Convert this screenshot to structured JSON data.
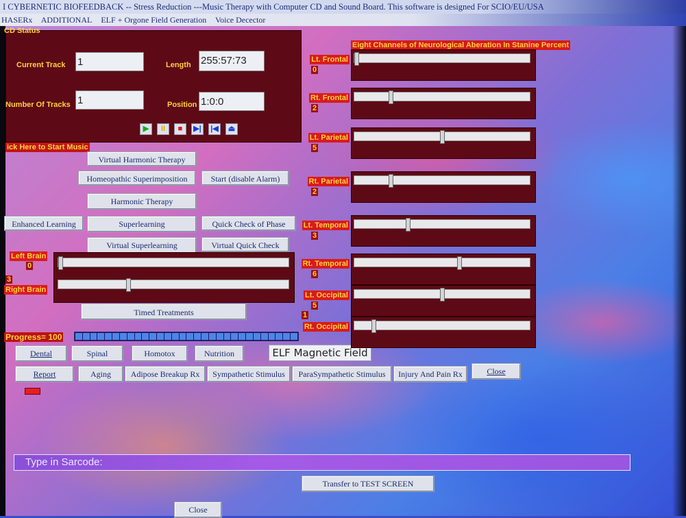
{
  "window": {
    "title": "I CYBERNETIC BIOFEEDBACK  --  Stress Reduction    ---Music Therapy with Computer CD and Sound Board.  This software is designed For SCIO/EU/USA"
  },
  "menu": [
    "HASERx",
    "ADDITIONAL",
    "ELF + Orgone Field Generation",
    "Voice Decector"
  ],
  "cd": {
    "status_label": "CD Status",
    "current_track_label": "Current Track",
    "current_track": "1",
    "length_label": "Length",
    "length": "255:57:73",
    "num_tracks_label": "Number Of Tracks",
    "num_tracks": "1",
    "position_label": "Position",
    "position": "1:0:0",
    "controls": [
      {
        "name": "play-icon",
        "glyph": "▶",
        "color": "#1aa81a"
      },
      {
        "name": "pause-icon",
        "glyph": "II",
        "color": "#e0b000"
      },
      {
        "name": "stop-icon",
        "glyph": "■",
        "color": "#d81c1c"
      },
      {
        "name": "next-track-icon",
        "glyph": "▶|",
        "color": "#1a3ad8"
      },
      {
        "name": "previous-track-icon",
        "glyph": "|◀",
        "color": "#1a3ad8"
      },
      {
        "name": "eject-icon",
        "glyph": "⏏",
        "color": "#1a3ad8"
      }
    ]
  },
  "start_music_label": "ick Here to Start Music",
  "buttons": {
    "virtual_harmonic": "Virtual Harmonic Therapy",
    "homeopathic": "Homeopathic Superimposition",
    "start_alarm": "Start (disable Alarm)",
    "harmonic": "Harmonic Therapy",
    "enhanced": "Enhanced Learning",
    "superlearning": "Superlearning",
    "quick_check": "Quick Check of Phase",
    "virtual_superlearning": "Virtual Superlearning",
    "virtual_quick": "Virtual Quick Check",
    "timed": "Timed Treatments",
    "dental": "Dental",
    "spinal": "Spinal",
    "homotox": "Homotox",
    "nutrition": "Nutrition",
    "report": "Report",
    "aging": "Aging",
    "adipose": "Adipose Breakup Rx",
    "sympathetic": "Sympathetic Stimulus",
    "parasympathetic": "ParaSympathetic Stimulus",
    "injury": "Injury And Pain Rx",
    "close": "Close",
    "transfer": "Transfer to TEST SCREEN",
    "close_bottom": "Close"
  },
  "brain": {
    "left_label": "Left Brain",
    "left_value": "0",
    "left_slider": 0,
    "mid_value": "3",
    "right_label": "Right Brain",
    "right_slider": 0.3
  },
  "progress": {
    "label": "Progress= 100",
    "value": 100
  },
  "elf_field": "ELF Magnetic Field",
  "channels": {
    "title": "Eight Channels of Neurological Aberation In Stanine Percent",
    "items": [
      {
        "label": "Lt. Frontal",
        "value": "0",
        "level": 0
      },
      {
        "label": "Rt. Frontal",
        "value": "2",
        "level": 0.2
      },
      {
        "label": "Lt. Parietal",
        "value": "5",
        "level": 0.5
      },
      {
        "label": "Rt. Parietal",
        "value": "2",
        "level": 0.2
      },
      {
        "label": "Lt. Temporal",
        "value": "3",
        "level": 0.3
      },
      {
        "label": "Rt. Temporal",
        "value": "6",
        "level": 0.6
      },
      {
        "label": "Lt. Occipital",
        "value": "5",
        "level": 0.5
      },
      {
        "label": "Rt. Occipital",
        "value": "1",
        "level": 0.1
      }
    ]
  },
  "sarcode_label": "Type in Sarcode:"
}
